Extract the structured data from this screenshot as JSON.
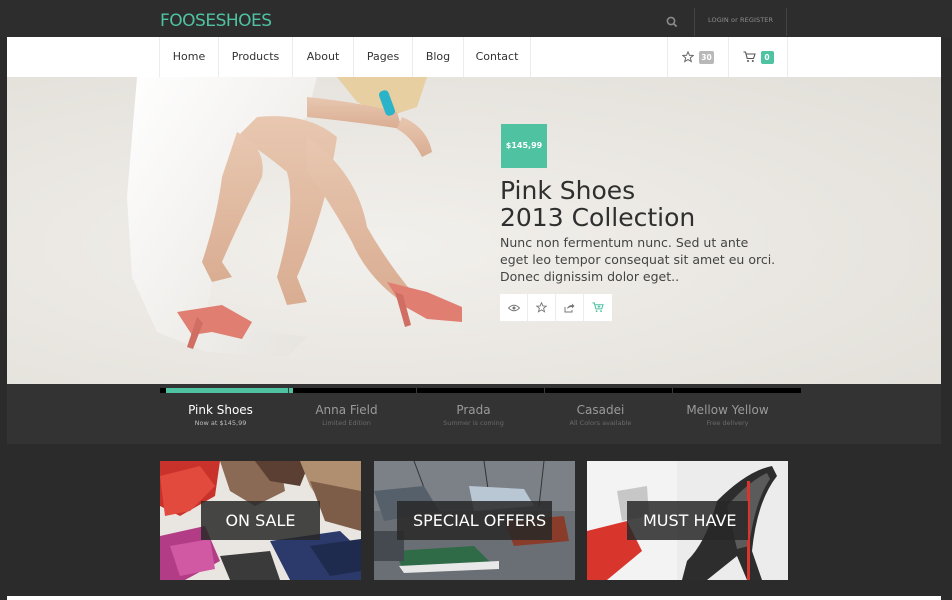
{
  "header": {
    "logo": "FOOSESHOES",
    "login_register": "LOGIN or REGISTER"
  },
  "nav": {
    "items": [
      "Home",
      "Products",
      "About",
      "Pages",
      "Blog",
      "Contact"
    ],
    "wishlist_count": "30",
    "cart_count": "0"
  },
  "hero": {
    "price": "$145,99",
    "title_line1": "Pink Shoes",
    "title_line2": "2013 Collection",
    "desc_line1": "Nunc non fermentum nunc. Sed ut ante",
    "desc_line2": "eget leo tempor consequat sit amet eu orci.",
    "desc_line3": "Donec dignissim dolor eget.."
  },
  "slider": {
    "progress": 0.2,
    "tabs": [
      {
        "title": "Pink Shoes",
        "subtitle": "Now at $145,99",
        "active": true
      },
      {
        "title": "Anna Field",
        "subtitle": "Limited Edition",
        "active": false
      },
      {
        "title": "Prada",
        "subtitle": "Summer is coming",
        "active": false
      },
      {
        "title": "Casadei",
        "subtitle": "All Colors available",
        "active": false
      },
      {
        "title": "Mellow Yellow",
        "subtitle": "Free delivery",
        "active": false
      }
    ]
  },
  "promos": [
    {
      "label": "ON SALE"
    },
    {
      "label": "SPECIAL OFFERS"
    },
    {
      "label": "MUST HAVE"
    }
  ],
  "colors": {
    "accent": "#4fc3a1",
    "badge_gray": "#b8b8b8",
    "dark_bg": "#2b2b2b"
  },
  "icons": [
    "search-icon",
    "star-icon",
    "cart-icon",
    "eye-icon",
    "share-icon",
    "add-to-cart-icon"
  ]
}
